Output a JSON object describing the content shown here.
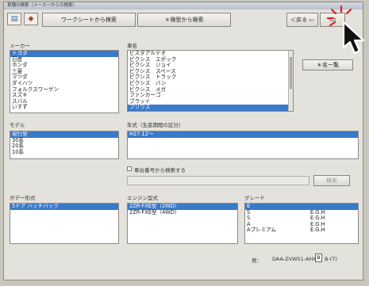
{
  "window": {
    "title": "車種の検索（メーカーからの検索）"
  },
  "toolbar": {
    "worksheet_search": "ワークシートから検索",
    "model_search": "＊検型から検索",
    "back": "＜戻る",
    "close_icon": "x-close-icon"
  },
  "maker": {
    "label": "メーカー",
    "items": [
      "トヨタ",
      "日産",
      "ホンダ",
      "三菱",
      "マツダ",
      "ダイハツ",
      "フォルクスワーゲン",
      "スズキ",
      "スバル",
      "いすず"
    ],
    "selected_index": 0
  },
  "car_name": {
    "label": "車名",
    "items": [
      "ビスタアルデオ",
      "ピクシス　エポック",
      "ピクシス　ジョイ",
      "ピクシス　スペース",
      "ピクシス　トラック",
      "ピクシス　バン",
      "ピクシス　メガ",
      "ファンカーゴ",
      "ブラッド",
      "プリウス"
    ],
    "selected_index": 9
  },
  "list_button": "＊名一覧",
  "model": {
    "label": "モデル",
    "items": [
      "現行型",
      "30系",
      "20系",
      "10系"
    ],
    "selected_index": 0
  },
  "year": {
    "label": "年式（生産期間の区分）",
    "items": [
      "H27.12～"
    ],
    "selected_index": 0
  },
  "chassis_search": {
    "label": "車台番号から検索する",
    "button": "検索"
  },
  "body_type": {
    "label": "ボデー形式",
    "items": [
      "5ドア ハッチバック"
    ],
    "selected_index": 0
  },
  "engine": {
    "label": "エンジン型式",
    "items": [
      "2ZR-FXE型（2WD）",
      "2ZR-FXE型（4WD）"
    ],
    "selected_index": 0
  },
  "grade": {
    "label": "グレード",
    "rows": [
      {
        "name": "E",
        "code": ""
      },
      {
        "name": "S",
        "code": "E.G.H"
      },
      {
        "name": "S",
        "code": "E.G.H"
      },
      {
        "name": "A",
        "code": "E.G.H"
      },
      {
        "name": "Aプレミアム",
        "code": "E.G.H"
      }
    ],
    "selected_index": 0
  },
  "example": {
    "label": "例：",
    "code": "DAA-ZVW51-AHX",
    "box": "B",
    "suffix": "B-(T)"
  }
}
